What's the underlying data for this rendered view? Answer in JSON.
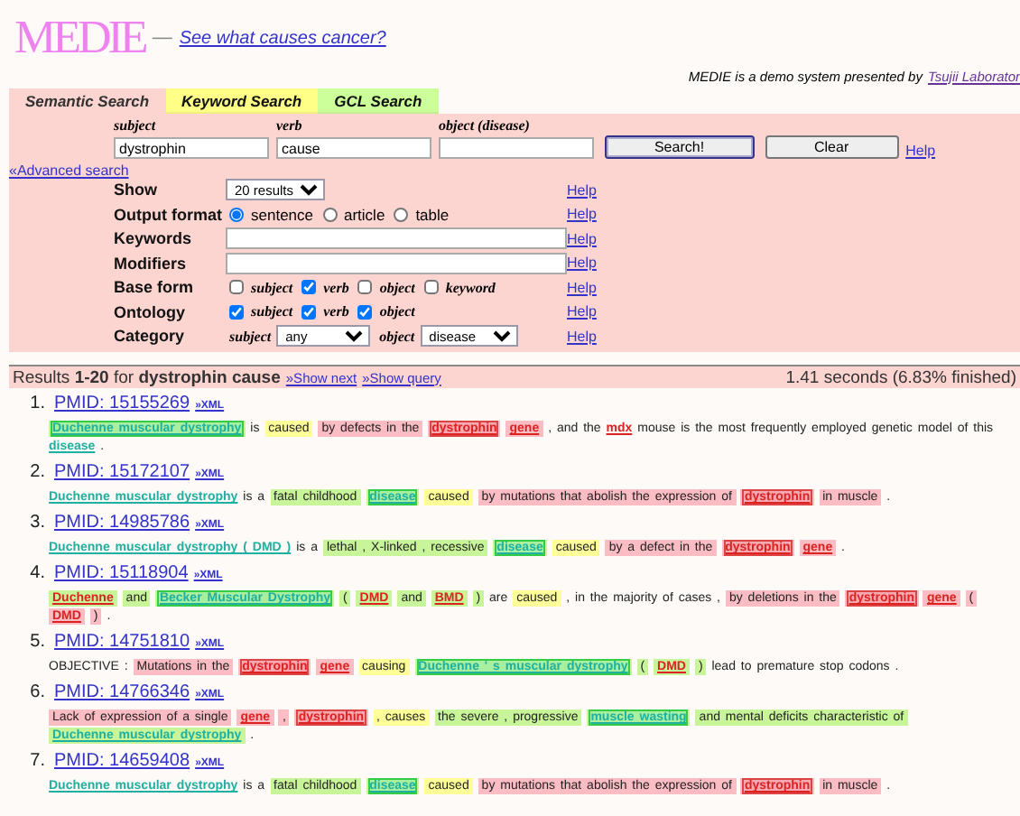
{
  "header": {
    "logo": "MEDIE",
    "dash": "—",
    "tagline_link": "See what causes cancer?",
    "credit": "MEDIE is a demo system presented by",
    "credit_link": "Tsujii Laborator"
  },
  "tabs": [
    {
      "label": "Semantic Search",
      "selected": true,
      "color": "#fdd5d0"
    },
    {
      "label": "Keyword Search",
      "selected": false,
      "color": "#ffff88"
    },
    {
      "label": "GCL Search",
      "selected": false,
      "color": "#ccff99"
    }
  ],
  "query": {
    "fields": [
      {
        "label": "subject",
        "value": "dystrophin"
      },
      {
        "label": "verb",
        "value": "cause"
      },
      {
        "label": "object (disease)"
      }
    ],
    "buttons": [
      "Search!",
      "Clear"
    ],
    "help": "Help"
  },
  "advanced_link": "«Advanced search",
  "options": [
    {
      "kind": "select",
      "label": "Show",
      "value": "20 results",
      "help": "Help"
    },
    {
      "kind": "radio",
      "label": "Output format",
      "choices": [
        {
          "label": "sentence",
          "selected": true
        },
        {
          "label": "article",
          "selected": false
        },
        {
          "label": "table",
          "selected": false
        }
      ],
      "help": "Help"
    },
    {
      "kind": "input",
      "label": "Keywords",
      "help": "Help"
    },
    {
      "kind": "input",
      "label": "Modifiers",
      "help": "Help"
    },
    {
      "kind": "checks",
      "label": "Base form",
      "choices": [
        {
          "label": "subject",
          "checked": false
        },
        {
          "label": "verb",
          "checked": true
        },
        {
          "label": "object",
          "checked": false
        },
        {
          "label": "keyword",
          "checked": false
        }
      ],
      "help": "Help"
    },
    {
      "kind": "checks",
      "label": "Ontology",
      "choices": [
        {
          "label": "subject",
          "checked": true
        },
        {
          "label": "verb",
          "checked": true
        },
        {
          "label": "object",
          "checked": true
        }
      ],
      "help": "Help"
    },
    {
      "kind": "category",
      "label": "Category",
      "selects": [
        {
          "label": "subject",
          "value": "any"
        },
        {
          "label": "object",
          "value": "disease"
        }
      ],
      "help": "Help"
    }
  ],
  "results_bar": {
    "summary": "Results **1-20** for **dystrophin cause**",
    "links": [
      "»Show next",
      "»Show query"
    ],
    "timing": "1.41 seconds (6.83% finished)"
  },
  "results": [
    {
      "number": "1.",
      "pmid": "PMID: 15155269",
      "xml": "»XML",
      "segments": [
        {
          "text": "Duchenne muscular dystrophy",
          "kind": "disease-key",
          "color": "#c8f59a"
        },
        {
          "text": "is",
          "kind": "text"
        },
        {
          "text": "caused",
          "kind": "text",
          "color": "#ffff99"
        },
        {
          "text": "by defects in the",
          "kind": "text",
          "color": "#fbbcc4"
        },
        {
          "text": "dystrophin",
          "kind": "gene-key",
          "color": "#fbbcc4"
        },
        {
          "text": "gene",
          "kind": "gene",
          "color": "#fbbcc4"
        },
        {
          "text": ", and the",
          "kind": "text"
        },
        {
          "text": "mdx",
          "kind": "gene"
        },
        {
          "text": "mouse is the most frequently employed genetic model of this",
          "kind": "text"
        },
        {
          "text": "disease",
          "kind": "disease"
        },
        {
          "text": ".",
          "kind": "text"
        }
      ]
    },
    {
      "number": "2.",
      "pmid": "PMID: 15172107",
      "xml": "»XML",
      "segments": [
        {
          "text": "Duchenne muscular dystrophy",
          "kind": "disease"
        },
        {
          "text": "is a",
          "kind": "text"
        },
        {
          "text": "fatal childhood",
          "kind": "text",
          "color": "#c8f59a"
        },
        {
          "text": "disease",
          "kind": "disease-key",
          "color": "#c8f59a"
        },
        {
          "text": "caused",
          "kind": "text",
          "color": "#ffff99"
        },
        {
          "text": "by mutations that abolish the expression of",
          "kind": "text",
          "color": "#fbbcc4"
        },
        {
          "text": "dystrophin",
          "kind": "gene-key",
          "color": "#fbbcc4"
        },
        {
          "text": "in muscle",
          "kind": "text",
          "color": "#fbbcc4"
        },
        {
          "text": ".",
          "kind": "text"
        }
      ]
    },
    {
      "number": "3.",
      "pmid": "PMID: 14985786",
      "xml": "»XML",
      "segments": [
        {
          "text": "Duchenne muscular dystrophy ( DMD )",
          "kind": "disease"
        },
        {
          "text": "is a",
          "kind": "text"
        },
        {
          "text": "lethal , X-linked , recessive",
          "kind": "text",
          "color": "#c8f59a"
        },
        {
          "text": "disease",
          "kind": "disease-key",
          "color": "#c8f59a"
        },
        {
          "text": "caused",
          "kind": "text",
          "color": "#ffff99"
        },
        {
          "text": "by a defect in the",
          "kind": "text",
          "color": "#fbbcc4"
        },
        {
          "text": "dystrophin",
          "kind": "gene-key",
          "color": "#fbbcc4"
        },
        {
          "text": "gene",
          "kind": "gene",
          "color": "#fbbcc4"
        },
        {
          "text": ".",
          "kind": "text"
        }
      ]
    },
    {
      "number": "4.",
      "pmid": "PMID: 15118904",
      "xml": "»XML",
      "segments": [
        {
          "text": "Duchenne",
          "kind": "gene",
          "color": "#c8f59a"
        },
        {
          "text": "and",
          "kind": "text",
          "color": "#c8f59a"
        },
        {
          "text": "Becker Muscular Dystrophy",
          "kind": "disease-key",
          "color": "#c8f59a"
        },
        {
          "text": "(",
          "kind": "text",
          "color": "#c8f59a"
        },
        {
          "text": "DMD",
          "kind": "gene",
          "color": "#c8f59a"
        },
        {
          "text": "and",
          "kind": "text",
          "color": "#c8f59a"
        },
        {
          "text": "BMD",
          "kind": "gene",
          "color": "#c8f59a"
        },
        {
          "text": ")",
          "kind": "text",
          "color": "#c8f59a"
        },
        {
          "text": "are",
          "kind": "text"
        },
        {
          "text": "caused",
          "kind": "text",
          "color": "#ffff99"
        },
        {
          "text": ", in the majority of cases ,",
          "kind": "text"
        },
        {
          "text": "by deletions in the",
          "kind": "text",
          "color": "#fbbcc4"
        },
        {
          "text": "dystrophin",
          "kind": "gene-key",
          "color": "#fbbcc4"
        },
        {
          "text": "gene",
          "kind": "gene",
          "color": "#fbbcc4"
        },
        {
          "text": "(",
          "kind": "text",
          "color": "#fbbcc4"
        },
        {
          "text": "DMD",
          "kind": "gene",
          "color": "#fbbcc4"
        },
        {
          "text": ")",
          "kind": "text",
          "color": "#fbbcc4"
        },
        {
          "text": ".",
          "kind": "text"
        }
      ]
    },
    {
      "number": "5.",
      "pmid": "PMID: 14751810",
      "xml": "»XML",
      "segments": [
        {
          "text": "OBJECTIVE :",
          "kind": "text"
        },
        {
          "text": "Mutations in the",
          "kind": "text",
          "color": "#fbbcc4"
        },
        {
          "text": "dystrophin",
          "kind": "gene-key",
          "color": "#fbbcc4"
        },
        {
          "text": "gene",
          "kind": "gene",
          "color": "#fbbcc4"
        },
        {
          "text": "causing",
          "kind": "text",
          "color": "#ffff99"
        },
        {
          "text": "Duchenne ' s muscular dystrophy",
          "kind": "disease-key",
          "color": "#c8f59a"
        },
        {
          "text": "(",
          "kind": "text",
          "color": "#c8f59a"
        },
        {
          "text": "DMD",
          "kind": "gene",
          "color": "#c8f59a"
        },
        {
          "text": ")",
          "kind": "text",
          "color": "#c8f59a"
        },
        {
          "text": "lead to premature stop codons .",
          "kind": "text"
        }
      ]
    },
    {
      "number": "6.",
      "pmid": "PMID: 14766346",
      "xml": "»XML",
      "segments": [
        {
          "text": "Lack of expression of a single",
          "kind": "text",
          "color": "#fbbcc4"
        },
        {
          "text": "gene",
          "kind": "gene",
          "color": "#fbbcc4"
        },
        {
          "text": ",",
          "kind": "text",
          "color": "#fbbcc4"
        },
        {
          "text": "dystrophin",
          "kind": "gene-key",
          "color": "#fbbcc4"
        },
        {
          "text": ", causes",
          "kind": "text",
          "color": "#ffff99"
        },
        {
          "text": "the severe , progressive",
          "kind": "text",
          "color": "#c8f59a"
        },
        {
          "text": "muscle wasting",
          "kind": "disease-key",
          "color": "#c8f59a"
        },
        {
          "text": "and mental deficits characteristic of",
          "kind": "text",
          "color": "#c8f59a"
        },
        {
          "text": "Duchenne muscular dystrophy",
          "kind": "disease",
          "color": "#c8f59a"
        },
        {
          "text": ".",
          "kind": "text"
        }
      ]
    },
    {
      "number": "7.",
      "pmid": "PMID: 14659408",
      "xml": "»XML",
      "segments": [
        {
          "text": "Duchenne muscular dystrophy",
          "kind": "disease"
        },
        {
          "text": "is a",
          "kind": "text"
        },
        {
          "text": "fatal childhood",
          "kind": "text",
          "color": "#c8f59a"
        },
        {
          "text": "disease",
          "kind": "disease-key",
          "color": "#c8f59a"
        },
        {
          "text": "caused",
          "kind": "text",
          "color": "#ffff99"
        },
        {
          "text": "by mutations that abolish the expression of",
          "kind": "text",
          "color": "#fbbcc4"
        },
        {
          "text": "dystrophin",
          "kind": "gene-key",
          "color": "#fbbcc4"
        },
        {
          "text": "in muscle",
          "kind": "text",
          "color": "#fbbcc4"
        },
        {
          "text": ".",
          "kind": "text"
        }
      ]
    }
  ]
}
